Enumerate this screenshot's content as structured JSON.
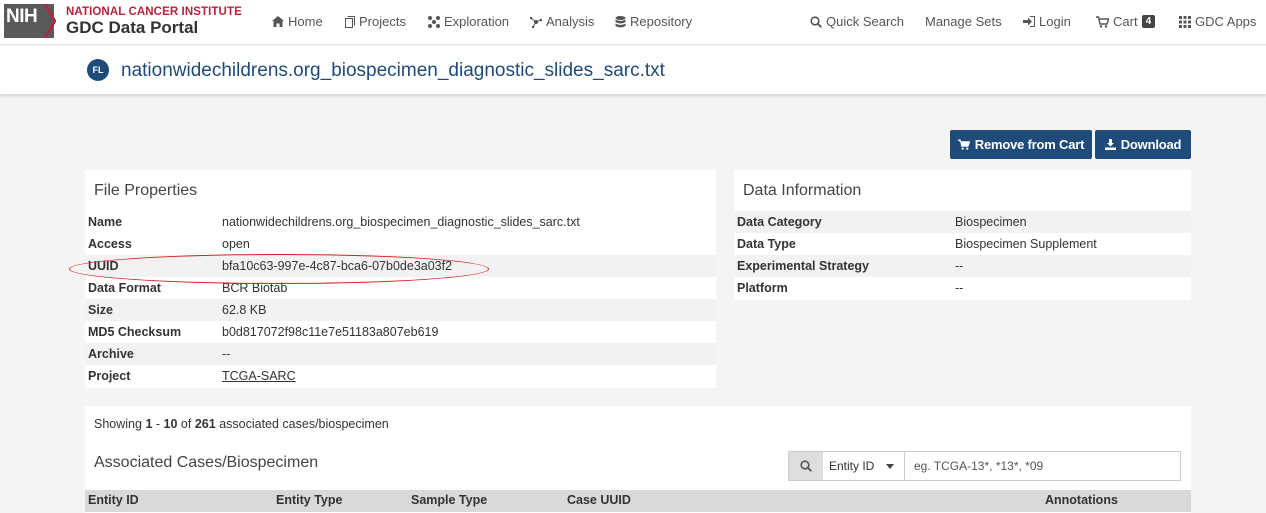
{
  "brand": {
    "logo": "NIH",
    "line1": "NATIONAL CANCER INSTITUTE",
    "line2": "GDC Data Portal",
    "colors": {
      "red": "#b8233a",
      "navy": "#1e4b7a"
    }
  },
  "nav": {
    "home": "Home",
    "projects": "Projects",
    "exploration": "Exploration",
    "analysis": "Analysis",
    "repository": "Repository",
    "quick_search": "Quick Search",
    "manage_sets": "Manage Sets",
    "login": "Login",
    "cart": "Cart",
    "cart_count": "4",
    "gdc_apps": "GDC Apps"
  },
  "page": {
    "badge": "FL",
    "title": "nationwidechildrens.org_biospecimen_diagnostic_slides_sarc.txt"
  },
  "actions": {
    "remove_from_cart": "Remove from Cart",
    "download": "Download"
  },
  "file_properties": {
    "title": "File Properties",
    "rows": [
      {
        "key": "Name",
        "value": "nationwidechildrens.org_biospecimen_diagnostic_slides_sarc.txt"
      },
      {
        "key": "Access",
        "value": "open"
      },
      {
        "key": "UUID",
        "value": "bfa10c63-997e-4c87-bca6-07b0de3a03f2"
      },
      {
        "key": "Data Format",
        "value": "BCR Biotab"
      },
      {
        "key": "Size",
        "value": "62.8 KB"
      },
      {
        "key": "MD5 Checksum",
        "value": "b0d817072f98c11e7e51183a807eb619"
      },
      {
        "key": "Archive",
        "value": "--"
      },
      {
        "key": "Project",
        "value": "TCGA-SARC"
      }
    ]
  },
  "data_information": {
    "title": "Data Information",
    "rows": [
      {
        "key": "Data Category",
        "value": "Biospecimen"
      },
      {
        "key": "Data Type",
        "value": "Biospecimen Supplement"
      },
      {
        "key": "Experimental Strategy",
        "value": "--"
      },
      {
        "key": "Platform",
        "value": "--"
      }
    ]
  },
  "cases": {
    "showing_prefix": "Showing",
    "from": "1",
    "dash": "-",
    "to": "10",
    "of": "of",
    "total": "261",
    "suffix": "associated cases/biospecimen",
    "title": "Associated Cases/Biospecimen",
    "search": {
      "field": "Entity ID",
      "placeholder": "eg. TCGA-13*, *13*, *09"
    },
    "columns": [
      "Entity ID",
      "Entity Type",
      "Sample Type",
      "Case UUID",
      "Annotations"
    ]
  }
}
